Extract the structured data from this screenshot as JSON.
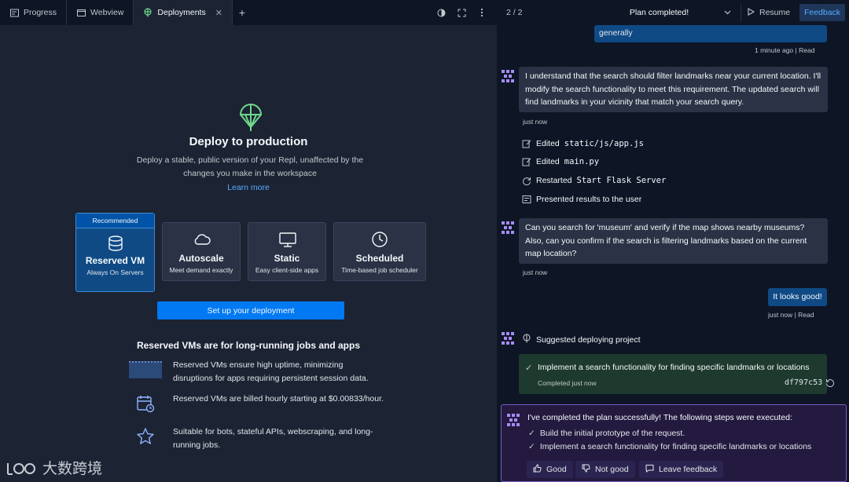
{
  "tabs": [
    {
      "label": "Progress",
      "icon": "progress-icon"
    },
    {
      "label": "Webview",
      "icon": "webview-icon"
    },
    {
      "label": "Deployments",
      "icon": "deploy-icon",
      "active": true
    }
  ],
  "deploy": {
    "title": "Deploy to production",
    "description": "Deploy a stable, public version of your Repl, unaffected by the changes you make in the workspace",
    "learn_more": "Learn more",
    "recommended_badge": "Recommended",
    "plans": [
      {
        "name": "Reserved VM",
        "sub": "Always On Servers",
        "icon": "database-icon"
      },
      {
        "name": "Autoscale",
        "sub": "Meet demand exactly",
        "icon": "cloud-icon"
      },
      {
        "name": "Static",
        "sub": "Easy client-side apps",
        "icon": "monitor-icon"
      },
      {
        "name": "Scheduled",
        "sub": "Time-based job scheduler",
        "icon": "clock-icon"
      }
    ],
    "setup_button": "Set up your deployment",
    "reserved_heading": "Reserved VMs are for long-running jobs and apps",
    "features": [
      {
        "text": "Reserved VMs ensure high uptime, minimizing disruptions for apps requiring persistent session data.",
        "icon": "uptime-icon"
      },
      {
        "text": "Reserved VMs are billed hourly starting at $0.00833/hour.",
        "icon": "calendar-icon"
      },
      {
        "text": "Suitable for bots, stateful APIs, webscraping, and long-running jobs.",
        "icon": "star-icon"
      }
    ]
  },
  "watermark": "大数跨境",
  "ai": {
    "plan_count": "2 / 2",
    "plan_status": "Plan completed!",
    "resume": "Resume",
    "feedback": "Feedback",
    "prev_user_msg": "generally",
    "prev_meta_time": "1 minute ago",
    "read": "Read",
    "msg1": "I understand that the search should filter landmarks near your current location. I'll modify the search functionality to meet this requirement. The updated search will find landmarks in your vicinity that match your search query.",
    "msg1_time": "just now",
    "actions": [
      {
        "verb": "Edited",
        "target": "static/js/app.js"
      },
      {
        "verb": "Edited",
        "target": "main.py"
      },
      {
        "verb": "Restarted",
        "target": "Start Flask Server"
      },
      {
        "verb": "Presented results to the user",
        "target": ""
      }
    ],
    "msg2": "Can you search for 'museum' and verify if the map shows nearby museums? Also, can you confirm if the search is filtering landmarks based on the current map location?",
    "msg2_time": "just now",
    "user_reply": "It looks good!",
    "user_reply_time": "just now",
    "suggest": "Suggested deploying project",
    "checkpoint": {
      "text": "Implement a search functionality for finding specific landmarks or locations",
      "status": "Completed just now",
      "hash": "df797c53"
    },
    "final": {
      "title": "I've completed the plan successfully! The following steps were executed:",
      "steps": [
        "Build the initial prototype of the request.",
        "Implement a search functionality for finding specific landmarks or locations"
      ],
      "good": "Good",
      "not_good": "Not good",
      "leave_feedback": "Leave feedback"
    }
  },
  "colors": {
    "accent": "#0079f2",
    "deploy_icon": "#6fd98b",
    "panel": "#1c2333",
    "background": "#0e1525"
  }
}
